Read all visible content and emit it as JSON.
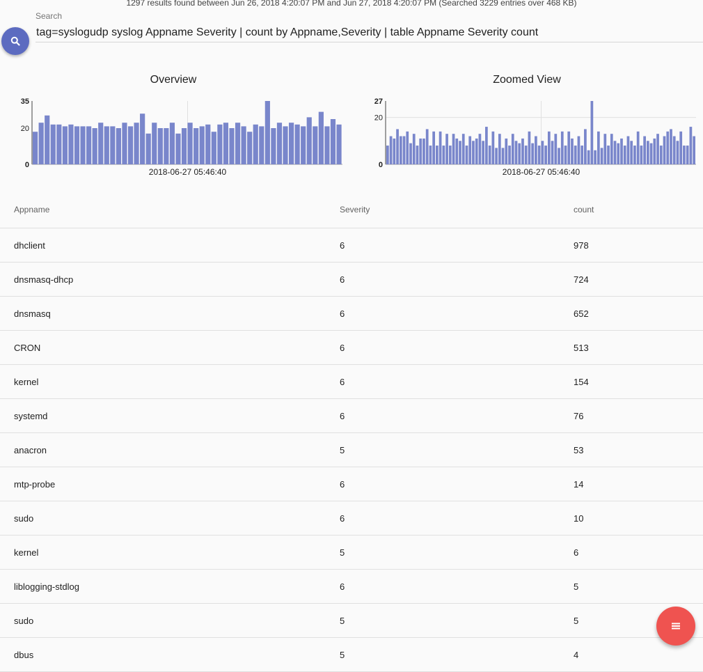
{
  "summary": "1297 results found between Jun 26, 2018 4:20:07 PM and Jun 27, 2018 4:20:07 PM (Searched 3229 entries over 468 KB)",
  "search": {
    "label": "Search",
    "query": "tag=syslogudp syslog Appname Severity | count by Appname,Severity | table Appname Severity count",
    "icon": "search-icon"
  },
  "colors": {
    "accent": "#5c6bc0",
    "bar": "#7986cb",
    "fab": "#ef5350"
  },
  "chart_data": [
    {
      "type": "bar",
      "title": "Overview",
      "x_center_label": "2018-06-27 05:46:40",
      "ylim": [
        0,
        35
      ],
      "y_ticks": [
        "0",
        "20",
        "35"
      ],
      "grid": "vertical at center",
      "values": [
        18,
        23,
        27,
        22,
        22,
        21,
        22,
        21,
        21,
        21,
        20,
        23,
        21,
        21,
        20,
        23,
        21,
        23,
        28,
        17,
        23,
        20,
        20,
        23,
        17,
        20,
        23,
        20,
        21,
        22,
        18,
        22,
        23,
        20,
        23,
        21,
        18,
        22,
        21,
        35,
        20,
        23,
        21,
        23,
        22,
        21,
        26,
        21,
        29,
        21,
        25,
        22
      ]
    },
    {
      "type": "bar",
      "title": "Zoomed View",
      "x_center_label": "2018-06-27 05:46:40",
      "ylim": [
        0,
        27
      ],
      "y_ticks": [
        "0",
        "20",
        "27"
      ],
      "grid": "horizontal at 20, vertical at center",
      "values": [
        8,
        12,
        11,
        15,
        12,
        12,
        14,
        9,
        13,
        8,
        11,
        11,
        15,
        8,
        14,
        8,
        14,
        8,
        13,
        8,
        13,
        11,
        10,
        13,
        8,
        12,
        10,
        11,
        13,
        10,
        16,
        8,
        14,
        7,
        13,
        7,
        11,
        8,
        13,
        10,
        9,
        11,
        8,
        14,
        9,
        12,
        8,
        10,
        8,
        14,
        10,
        13,
        7,
        14,
        8,
        14,
        11,
        8,
        12,
        8,
        15,
        6,
        27,
        6,
        14,
        7,
        13,
        8,
        13,
        10,
        9,
        11,
        8,
        12,
        10,
        8,
        14,
        8,
        12,
        10,
        9,
        11,
        13,
        8,
        12,
        14,
        15,
        12,
        10,
        14,
        8,
        8,
        16,
        12
      ]
    }
  ],
  "table": {
    "columns": [
      "Appname",
      "Severity",
      "count"
    ],
    "rows": [
      [
        "dhclient",
        "6",
        "978"
      ],
      [
        "dnsmasq-dhcp",
        "6",
        "724"
      ],
      [
        "dnsmasq",
        "6",
        "652"
      ],
      [
        "CRON",
        "6",
        "513"
      ],
      [
        "kernel",
        "6",
        "154"
      ],
      [
        "systemd",
        "6",
        "76"
      ],
      [
        "anacron",
        "5",
        "53"
      ],
      [
        "mtp-probe",
        "6",
        "14"
      ],
      [
        "sudo",
        "6",
        "10"
      ],
      [
        "kernel",
        "5",
        "6"
      ],
      [
        "liblogging-stdlog",
        "6",
        "5"
      ],
      [
        "sudo",
        "5",
        "5"
      ],
      [
        "dbus",
        "5",
        "4"
      ]
    ]
  },
  "fab": {
    "icon": "menu-lines-icon"
  }
}
